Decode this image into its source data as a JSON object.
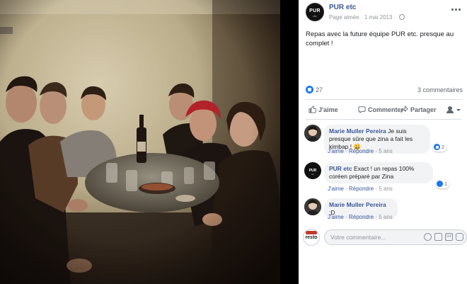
{
  "post": {
    "page_name": "PUR etc",
    "page_avatar_text": "PUR",
    "page_avatar_subtext": "etc",
    "liked_label": "Page aimée",
    "separator": "·",
    "date": "1 mai 2013",
    "caption": "Repas avec la future équipe PUR etc. presque au complet !",
    "like_count": "27",
    "comment_count": "3 commentaires"
  },
  "actions": {
    "like": "J'aime",
    "comment": "Commenter",
    "share": "Partager"
  },
  "comments": [
    {
      "author": "Marie Muller Pereira",
      "text": "Je suis presque sûre que zina a fait les kimbap ! 😀",
      "like": "J'aime",
      "reply": "Répondre",
      "time": "5 ans",
      "reaction_count": "2"
    },
    {
      "author": "PUR etc",
      "text": "Exact ! un repas 100% coréen préparé par Zina",
      "like": "J'aime",
      "reply": "Répondre",
      "time": "5 ans",
      "reaction_count": "1"
    },
    {
      "author": "Marie Muller Pereira",
      "text": ";D",
      "like": "J'aime",
      "reply": "Répondre",
      "time": "5 ans"
    }
  ],
  "composer": {
    "avatar_text": "resto",
    "placeholder": "Votre commentaire..."
  },
  "colors": {
    "link_blue": "#385898",
    "like_blue": "#1877f2",
    "muted": "#90949c",
    "bubble": "#f2f3f5"
  },
  "icons": [
    "more-options-icon",
    "globe-icon",
    "like-reaction-icon",
    "thumbs-up-icon",
    "comment-icon",
    "share-icon",
    "audience-selector-icon",
    "emoji-icon",
    "camera-icon",
    "gif-icon",
    "sticker-icon"
  ]
}
